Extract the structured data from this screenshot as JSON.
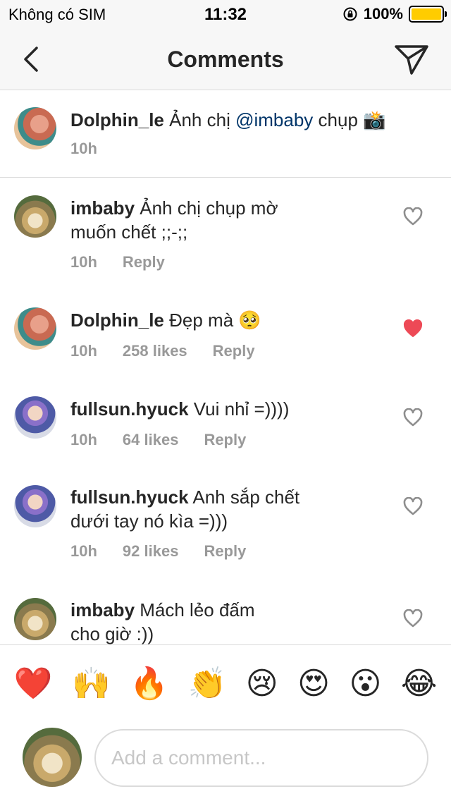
{
  "status_bar": {
    "carrier": "Không có SIM",
    "time": "11:32",
    "battery": "100%"
  },
  "nav": {
    "title": "Comments"
  },
  "caption": {
    "user": "Dolphin_le",
    "text_before": " Ảnh chị ",
    "mention": "@imbaby",
    "text_after": " chụp 📸",
    "time": "10h"
  },
  "comments": [
    {
      "user": "imbaby",
      "line1": " Ảnh chị chụp mờ",
      "line2": "muốn chết ;;-;;",
      "time": "10h",
      "likes": "",
      "reply": "Reply",
      "liked": false
    },
    {
      "user": "Dolphin_le",
      "line1": " Đẹp mà 🥺",
      "line2": "",
      "time": "10h",
      "likes": "258 likes",
      "reply": "Reply",
      "liked": true
    },
    {
      "user": "fullsun.hyuck",
      "line1": " Vui nhỉ =))))",
      "line2": "",
      "time": "10h",
      "likes": "64 likes",
      "reply": "Reply",
      "liked": false
    },
    {
      "user": "fullsun.hyuck",
      "line1": " Anh sắp chết",
      "line2": "dưới tay nó kìa =)))",
      "time": "10h",
      "likes": "92 likes",
      "reply": "Reply",
      "liked": false
    },
    {
      "user": "imbaby",
      "line1": " Mách lẻo đấm",
      "line2": "cho giờ :))",
      "time": "",
      "likes": "",
      "reply": "",
      "liked": false
    }
  ],
  "emoji_bar": [
    "❤️",
    "🙌",
    "🔥",
    "👏",
    "😢",
    "😍",
    "😮",
    "😂"
  ],
  "composer": {
    "placeholder": "Add a comment..."
  },
  "colors": {
    "heart_liked": "#ed4956",
    "mention": "#003569",
    "meta": "#999999"
  }
}
